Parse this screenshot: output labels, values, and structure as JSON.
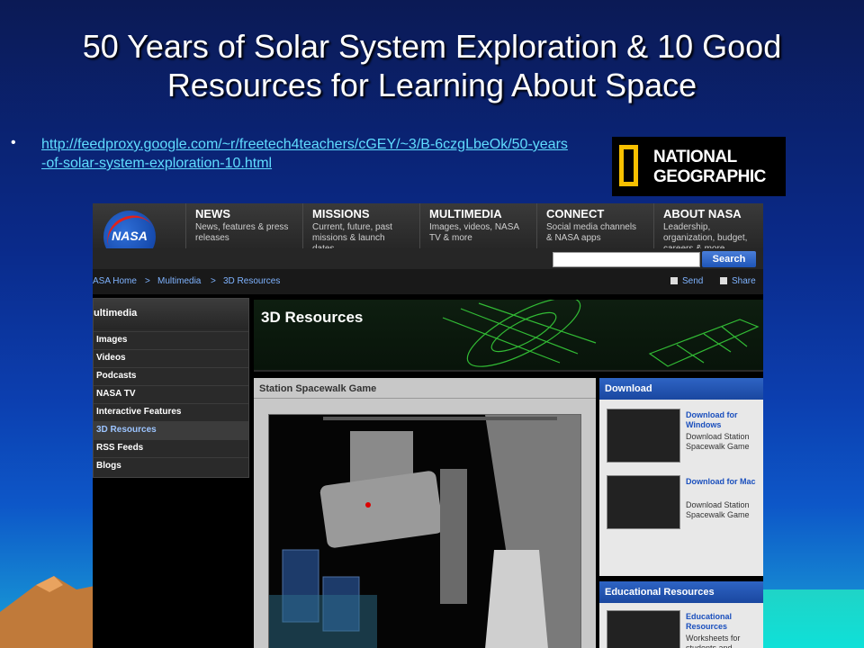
{
  "slide": {
    "title": "50 Years of Solar System Exploration & 10 Good Resources for Learning About Space",
    "bullet": "•",
    "link": "http://feedproxy.google.com/~r/freetech4teachers/cGEY/~3/B-6czgLbeOk/50-years-of-solar-system-exploration-10.html"
  },
  "natgeo": {
    "line1": "NATIONAL",
    "line2": "GEOGRAPHIC"
  },
  "nasa": {
    "logo_text": "NASA",
    "nav": [
      {
        "title": "NEWS",
        "desc": "News, features & press releases"
      },
      {
        "title": "MISSIONS",
        "desc": "Current, future, past missions & launch dates"
      },
      {
        "title": "MULTIMEDIA",
        "desc": "Images, videos, NASA TV & more"
      },
      {
        "title": "CONNECT",
        "desc": "Social media channels & NASA apps"
      },
      {
        "title": "ABOUT NASA",
        "desc": "Leadership, organization, budget, careers & more"
      }
    ],
    "search_button": "Search",
    "breadcrumbs": [
      "ASA Home",
      "Multimedia",
      "3D Resources"
    ],
    "crumb_sep": ">",
    "send": "Send",
    "share": "Share",
    "left_nav": {
      "heading": "ultimedia",
      "items": [
        "Images",
        "Videos",
        "Podcasts",
        "NASA TV",
        "Interactive Features",
        "3D Resources",
        "RSS Feeds",
        "Blogs"
      ]
    },
    "banner_title": "3D Resources",
    "game_title": "Station Spacewalk Game",
    "download": {
      "heading": "Download",
      "items": [
        {
          "link": "Download for Windows",
          "sub": "Download Station Spacewalk Game"
        },
        {
          "link": "Download for Mac",
          "sub": "Download Station Spacewalk Game"
        }
      ]
    },
    "edu": {
      "heading": "Educational Resources",
      "link": "Educational Resources",
      "sub": "Worksheets for students and"
    }
  }
}
